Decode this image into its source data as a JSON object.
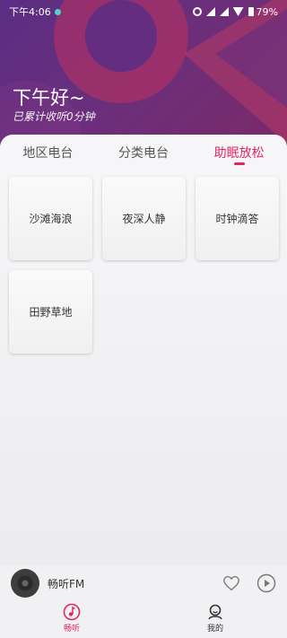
{
  "status_bar": {
    "time": "下午4:06",
    "battery": "79%",
    "icons": [
      "shield-dot-icon",
      "alarm-icon",
      "signal-icon",
      "signal-icon",
      "wifi-icon",
      "battery-icon"
    ]
  },
  "header": {
    "greeting": "下午好~",
    "listen_summary": "已累计收听0分钟"
  },
  "tabs": [
    {
      "label": "地区电台",
      "active": false
    },
    {
      "label": "分类电台",
      "active": false
    },
    {
      "label": "助眠放松",
      "active": true
    }
  ],
  "cards": [
    {
      "label": "沙滩海浪"
    },
    {
      "label": "夜深人静"
    },
    {
      "label": "时钟滴答"
    },
    {
      "label": "田野草地"
    }
  ],
  "player": {
    "station": "畅听FM",
    "icons": [
      "disc-icon",
      "heart-icon",
      "play-icon"
    ]
  },
  "bottom_nav": [
    {
      "label": "畅听",
      "icon": "music-note-icon",
      "active": true
    },
    {
      "label": "我的",
      "icon": "profile-icon",
      "active": false
    }
  ],
  "colors": {
    "accent": "#e0275f",
    "header_purple": "#5b2d84",
    "header_magenta": "#7b2a68"
  }
}
